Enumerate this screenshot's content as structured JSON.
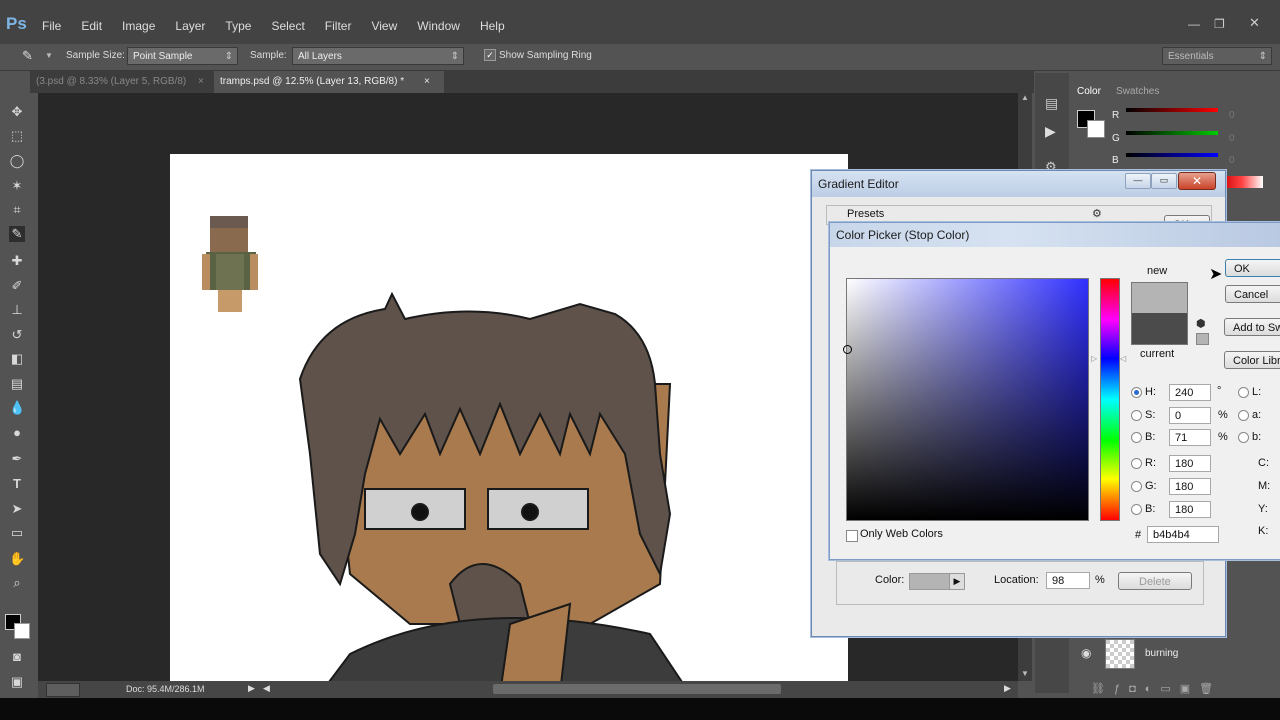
{
  "app": {
    "logo": "Ps",
    "menu": [
      "File",
      "Edit",
      "Image",
      "Layer",
      "Type",
      "Select",
      "Filter",
      "View",
      "Window",
      "Help"
    ]
  },
  "options": {
    "sample_size_label": "Sample Size:",
    "sample_size_value": "Point Sample",
    "sample_label": "Sample:",
    "sample_value": "All Layers",
    "show_ring_label": "Show Sampling Ring",
    "workspace": "Essentials"
  },
  "tabs": [
    {
      "label": "(3.psd @ 8.33% (Layer 5, RGB/8)"
    },
    {
      "label": "tramps.psd @ 12.5% (Layer 13, RGB/8) *"
    }
  ],
  "status": {
    "doc": "Doc: 95.4M/286.1M"
  },
  "color_panel": {
    "tab_color": "Color",
    "tab_swatches": "Swatches",
    "r": "R",
    "g": "G",
    "b": "B",
    "zero": "0"
  },
  "layers": {
    "layer_name": "burning"
  },
  "gradient_editor": {
    "title": "Gradient Editor",
    "presets": "Presets",
    "ok": "OK",
    "color_label": "Color:",
    "location_label": "Location:",
    "location_value": "98",
    "percent": "%",
    "delete": "Delete"
  },
  "color_picker": {
    "title": "Color Picker (Stop Color)",
    "new_label": "new",
    "current_label": "current",
    "ok": "OK",
    "cancel": "Cancel",
    "add_to_swatches": "Add to Swatches",
    "color_libraries": "Color Libraries",
    "only_web": "Only Web Colors",
    "hsb": {
      "h_label": "H:",
      "h": "240",
      "h_unit": "°",
      "s_label": "S:",
      "s": "0",
      "s_unit": "%",
      "b_label": "B:",
      "b": "71",
      "b_unit": "%"
    },
    "rgb": {
      "r_label": "R:",
      "r": "180",
      "g_label": "G:",
      "g": "180",
      "b_label": "B:",
      "b": "180"
    },
    "lab": {
      "l_label": "L:",
      "a_label": "a:",
      "b_label": "b:"
    },
    "cmyk": {
      "c_label": "C:",
      "m_label": "M:",
      "y_label": "Y:",
      "k_label": "K:"
    },
    "hash": "#",
    "hex": "b4b4b4",
    "colors": {
      "new": "#b4b4b4",
      "current": "#4b4b4b"
    }
  }
}
